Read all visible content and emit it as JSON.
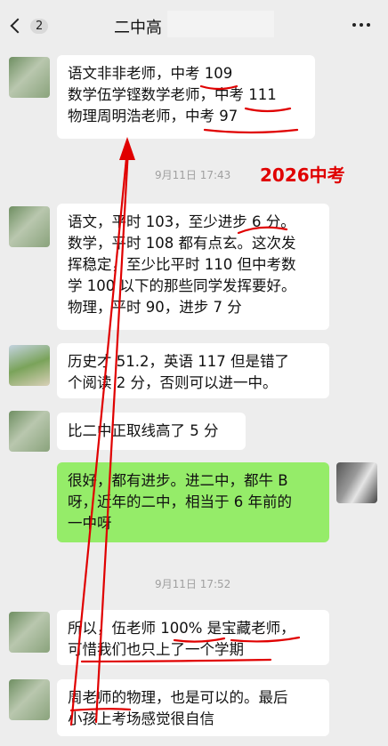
{
  "header": {
    "back_count": "2",
    "title": "二中高"
  },
  "watermark_text": "2026中考",
  "messages": [
    {
      "lines": [
        "语文非非老师，中考 109",
        "数学伍学铿数学老师，中考 111",
        "物理周明浩老师，中考 97"
      ]
    },
    {
      "time": "9月11日 17:43"
    },
    {
      "lines": [
        "语文，平时 103，至少进步 6 分。",
        "数学，平时 108 都有点玄。这次发",
        "挥稳定，至少比平时 110 但中考数",
        "学 100 以下的那些同学发挥要好。",
        "物理，平时 90，进步 7 分"
      ]
    },
    {
      "lines": [
        "历史才 51.2，英语 117 但是错了",
        "个阅读 2 分，否则可以进一中。"
      ]
    },
    {
      "lines": [
        "比二中正取线高了 5 分"
      ]
    },
    {
      "lines": [
        "很好，都有进步。进二中，都牛 B",
        "呀，近年的二中，相当于 6 年前的",
        "一中呀"
      ]
    },
    {
      "time": "9月11日 17:52"
    },
    {
      "lines": [
        "所以，伍老师 100% 是宝藏老师，",
        "可惜我们也只上了一个学期"
      ]
    },
    {
      "lines": [
        "周老师的物理，也是可以的。最后",
        "小孩上考场感觉很自信"
      ]
    }
  ],
  "colors": {
    "background": "#ededed",
    "incoming_bubble": "#ffffff",
    "outgoing_bubble": "#95ec69",
    "annotation": "#e00000"
  }
}
